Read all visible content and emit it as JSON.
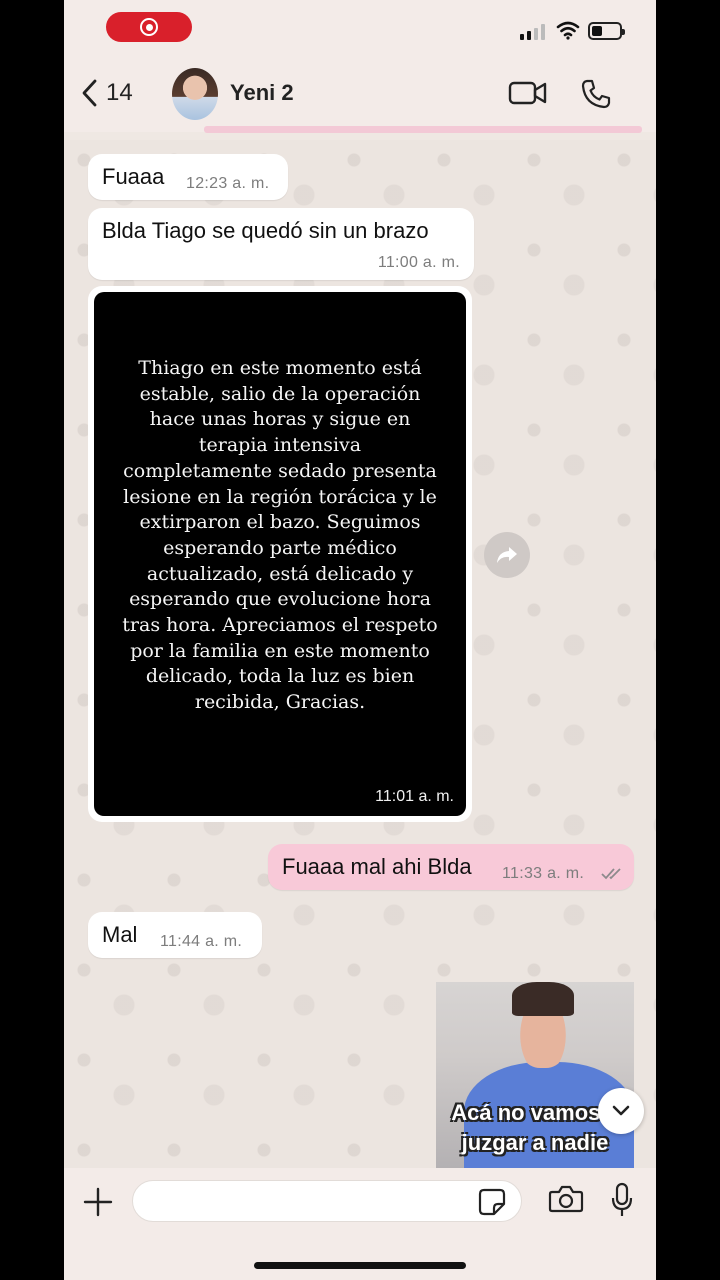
{
  "status_bar": {
    "battery_level": 0.4
  },
  "header": {
    "back_count": "14",
    "contact_name": "Yeni 2"
  },
  "messages": [
    {
      "direction": "in",
      "text": "Fuaaa",
      "time": "12:23 a. m."
    },
    {
      "direction": "in",
      "text": "Blda Tiago se quedó sin un brazo",
      "time": "11:00 a. m."
    },
    {
      "direction": "in",
      "type": "image",
      "caption": "Thiago en este momento está estable, salio de la operación hace unas horas y sigue en terapia intensiva completamente sedado presenta lesione en la región torácica y le extirparon el bazo. Seguimos esperando parte médico actualizado, está delicado y esperando que evolucione hora tras hora. Apreciamos el respeto por la familia en este momento delicado, toda la luz es bien recibida, Gracias.",
      "time": "11:01 a. m."
    },
    {
      "direction": "out",
      "text": "Fuaaa mal ahi Blda",
      "time": "11:33 a. m.",
      "status": "read"
    },
    {
      "direction": "in",
      "text": "Mal",
      "time": "11:44 a. m."
    }
  ],
  "video_overlay": {
    "caption": "Acá no vamos a juzgar a nadie"
  },
  "composer": {
    "value": "",
    "placeholder": ""
  },
  "colors": {
    "outgoing_bubble": "#f8c9d8",
    "incoming_bubble": "#ffffff",
    "record_pill": "#d9202b",
    "accent_line": "#f3c9d6"
  }
}
